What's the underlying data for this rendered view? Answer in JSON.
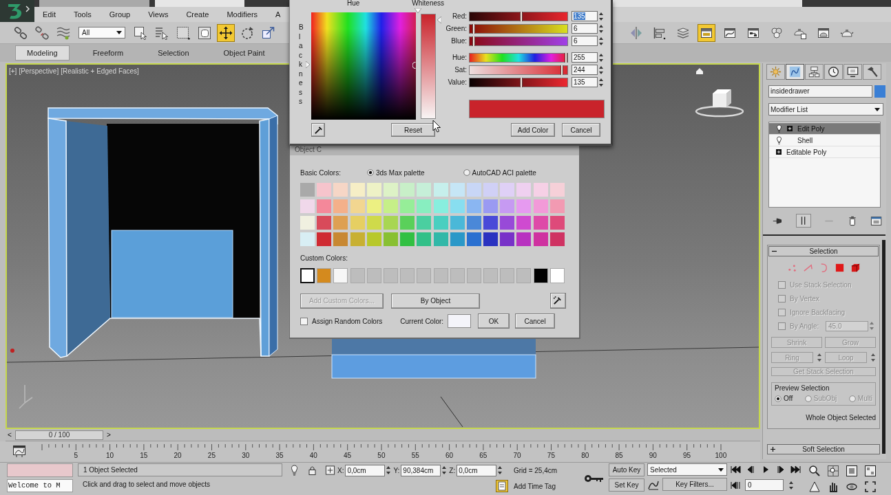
{
  "menu_bar": [
    "Edit",
    "Tools",
    "Group",
    "Views",
    "Create",
    "Modifiers",
    "A"
  ],
  "main_toolbar": {
    "link_tools": [
      {
        "kind": "link",
        "active": false
      },
      {
        "kind": "unlink",
        "active": false
      },
      {
        "kind": "bind",
        "active": false
      }
    ],
    "selection_filter": "All",
    "select_tools": [
      {
        "kind": "select",
        "active": false
      },
      {
        "kind": "select_by_name",
        "active": false
      },
      {
        "kind": "region",
        "active": false
      },
      {
        "kind": "crossing",
        "active": false
      },
      {
        "kind": "move",
        "active": true
      },
      {
        "kind": "rotate",
        "active": false
      },
      {
        "kind": "scale",
        "active": false
      }
    ],
    "right_tools": [
      {
        "kind": "mirror",
        "active": false
      },
      {
        "kind": "align",
        "active": false
      },
      {
        "kind": "layers",
        "active": false
      },
      {
        "kind": "ribbon",
        "active": true
      },
      {
        "kind": "curve_editor",
        "active": false
      },
      {
        "kind": "schematic",
        "active": false
      },
      {
        "kind": "material",
        "active": false
      },
      {
        "kind": "render_setup",
        "active": false
      },
      {
        "kind": "frame_window",
        "active": false
      },
      {
        "kind": "render",
        "active": false
      }
    ]
  },
  "ribbon_tabs": [
    {
      "label": "Modeling",
      "selected": true
    },
    {
      "label": "Freeform",
      "selected": false
    },
    {
      "label": "Selection",
      "selected": false
    },
    {
      "label": "Object Paint",
      "selected": false
    }
  ],
  "viewport": {
    "labels": [
      "[+]",
      "[Perspective]",
      "[Realistic + Edged Faces]"
    ]
  },
  "color_selector": {
    "hue_label": "Hue",
    "whiteness_label": "Whiteness",
    "blackness_label": "Blackness",
    "channels": [
      {
        "kind": "red",
        "label": "Red:",
        "value": "135",
        "level": 0.53,
        "focused": true
      },
      {
        "kind": "green",
        "label": "Green:",
        "value": "6",
        "level": 0.03,
        "focused": false
      },
      {
        "kind": "blue",
        "label": "Blue:",
        "value": "6",
        "level": 0.03,
        "focused": false
      },
      {
        "kind": "hue",
        "label": "Hue:",
        "value": "255",
        "level": 1.0,
        "focused": false
      },
      {
        "kind": "sat",
        "label": "Sat:",
        "value": "244",
        "level": 0.96,
        "focused": false
      },
      {
        "kind": "value",
        "label": "Value:",
        "value": "135",
        "level": 0.53,
        "focused": false
      }
    ],
    "preview": {
      "color": "#c9232b"
    },
    "reset_button": "Reset",
    "add_color_button": "Add Color",
    "cancel_button": "Cancel"
  },
  "object_color": {
    "title": "Object C",
    "basic_colors_label": "Basic Colors:",
    "palettes": [
      {
        "label": "3ds Max palette",
        "selected": true
      },
      {
        "label": "AutoCAD ACI palette",
        "selected": false
      }
    ],
    "basic_colors": [
      [
        {
          "color": "#a9a9a9"
        },
        {
          "color": "#f6c4cc"
        },
        {
          "color": "#f6d6c6"
        },
        {
          "color": "#f6eec6"
        },
        {
          "color": "#eef2c6"
        },
        {
          "color": "#ddf2c6"
        },
        {
          "color": "#c8efc8"
        },
        {
          "color": "#c6efd8"
        },
        {
          "color": "#c6efec"
        },
        {
          "color": "#c6e6f6"
        },
        {
          "color": "#c8d6f6"
        },
        {
          "color": "#d0d0f6"
        },
        {
          "color": "#dfd0f6"
        },
        {
          "color": "#efd0f0"
        },
        {
          "color": "#f6d0e6"
        },
        {
          "color": "#f6d0d8"
        }
      ],
      [
        {
          "color": "#f0d8ea"
        },
        {
          "color": "#f4889a"
        },
        {
          "color": "#f4b08a"
        },
        {
          "color": "#f2d690"
        },
        {
          "color": "#ecf082"
        },
        {
          "color": "#c6ef88"
        },
        {
          "color": "#96ee98"
        },
        {
          "color": "#88eec0"
        },
        {
          "color": "#88eede"
        },
        {
          "color": "#88def0"
        },
        {
          "color": "#8ab6f2"
        },
        {
          "color": "#9a9af2"
        },
        {
          "color": "#c69af2"
        },
        {
          "color": "#e69af0"
        },
        {
          "color": "#f29ad8"
        },
        {
          "color": "#f29ab2"
        }
      ],
      [
        {
          "color": "#f0f0e0"
        },
        {
          "color": "#d84a5a"
        },
        {
          "color": "#dea052"
        },
        {
          "color": "#e6cf62"
        },
        {
          "color": "#cfda4a"
        },
        {
          "color": "#a8d652"
        },
        {
          "color": "#5ad05a"
        },
        {
          "color": "#4acfa0"
        },
        {
          "color": "#4acfc0"
        },
        {
          "color": "#4ab8d8"
        },
        {
          "color": "#4a88d8"
        },
        {
          "color": "#4a4ad8"
        },
        {
          "color": "#984ad8"
        },
        {
          "color": "#cf4ad0"
        },
        {
          "color": "#de4aa8"
        },
        {
          "color": "#de4a7a"
        }
      ],
      [
        {
          "color": "#d8eef4"
        },
        {
          "color": "#cf2a32"
        },
        {
          "color": "#c88832"
        },
        {
          "color": "#c8b032"
        },
        {
          "color": "#b8c82a"
        },
        {
          "color": "#88c032"
        },
        {
          "color": "#32c042"
        },
        {
          "color": "#32c088"
        },
        {
          "color": "#32b8a8"
        },
        {
          "color": "#2a98c8"
        },
        {
          "color": "#2a70d0"
        },
        {
          "color": "#2a32c0"
        },
        {
          "color": "#7832c8"
        },
        {
          "color": "#b832c0"
        },
        {
          "color": "#cf32a0"
        },
        {
          "color": "#cf3262"
        }
      ]
    ],
    "custom_colors_label": "Custom Colors:",
    "custom_colors": [
      {
        "color": "#ffffff",
        "selected": true
      },
      {
        "color": "#d48a1e",
        "selected": false
      },
      {
        "color": "#f6f6f6",
        "selected": false
      },
      {
        "color": "#bdbdbd",
        "selected": false
      },
      {
        "color": "#bdbdbd",
        "selected": false
      },
      {
        "color": "#bdbdbd",
        "selected": false
      },
      {
        "color": "#bdbdbd",
        "selected": false
      },
      {
        "color": "#bdbdbd",
        "selected": false
      },
      {
        "color": "#bdbdbd",
        "selected": false
      },
      {
        "color": "#bdbdbd",
        "selected": false
      },
      {
        "color": "#bdbdbd",
        "selected": false
      },
      {
        "color": "#bdbdbd",
        "selected": false
      },
      {
        "color": "#bdbdbd",
        "selected": false
      },
      {
        "color": "#bdbdbd",
        "selected": false
      },
      {
        "color": "#000000",
        "selected": false
      },
      {
        "color": "#ffffff",
        "selected": false
      }
    ],
    "add_custom_button": {
      "label": "Add Custom Colors...",
      "disabled": true
    },
    "by_object_button": "By Object",
    "assign_random": {
      "label": "Assign Random Colors",
      "checked": false
    },
    "current_color": {
      "label": "Current Color:",
      "color": "#f4f4fa"
    },
    "ok_button": "OK",
    "cancel_button": "Cancel"
  },
  "command_panel": {
    "tabs": [
      {
        "kind": "create",
        "selected": false
      },
      {
        "kind": "modify",
        "selected": true
      },
      {
        "kind": "hierarchy",
        "selected": false
      },
      {
        "kind": "motion",
        "selected": false
      },
      {
        "kind": "display",
        "selected": false
      },
      {
        "kind": "utilities",
        "selected": false
      }
    ],
    "object_name": "insidedrawer",
    "object_swatch": {
      "color": "#3a7fd5"
    },
    "modifier_list": "Modifier List",
    "stack": [
      {
        "kind": "modifier",
        "label": "Edit Poly",
        "expandable": true,
        "selected": true
      },
      {
        "kind": "modifier",
        "label": "Shell",
        "expandable": false,
        "selected": false
      },
      {
        "kind": "base",
        "label": "Editable Poly",
        "expandable": true,
        "selected": false
      }
    ],
    "selection_rollout": {
      "title": "Selection",
      "expanded": true,
      "disabled": true,
      "options": [
        {
          "label": "Use Stack Selection",
          "checked": false
        },
        {
          "label": "By Vertex",
          "checked": false
        },
        {
          "label": "Ignore Backfacing",
          "checked": false
        }
      ],
      "by_angle": {
        "label": "By Angle:",
        "checked": false,
        "value": "45.0"
      },
      "shrink_button": "Shrink",
      "grow_button": "Grow",
      "ring_button": "Ring",
      "loop_button": "Loop",
      "get_stack_button": "Get Stack Selection",
      "preview": {
        "label": "Preview Selection",
        "options": [
          {
            "label": "Off",
            "selected": true,
            "disabled": false
          },
          {
            "label": "SubObj",
            "selected": false,
            "disabled": true
          },
          {
            "label": "Multi",
            "selected": false,
            "disabled": true
          }
        ]
      },
      "status": "Whole Object Selected"
    },
    "soft_selection_rollout": {
      "title": "Soft Selection",
      "expanded": false
    }
  },
  "time_slider": {
    "prev": "<",
    "position": "0 / 100",
    "next": ">",
    "level": 0
  },
  "track_bar": {
    "frames": [
      "5",
      "10",
      "15",
      "20",
      "25",
      "30",
      "35",
      "40",
      "45",
      "50",
      "55",
      "60",
      "65",
      "70",
      "75",
      "80",
      "85",
      "90",
      "95",
      "100"
    ]
  },
  "status_bar": {
    "listener_text": "Welcome to M",
    "selection_info": "1 Object Selected",
    "prompt": "Click and drag to select and move objects",
    "coords": [
      {
        "axis": "X:",
        "value": "0,0cm"
      },
      {
        "axis": "Y:",
        "value": "90,384cm"
      },
      {
        "axis": "Z:",
        "value": "0,0cm"
      }
    ],
    "grid": "Grid = 25,4cm",
    "time_tag": "Add Time Tag",
    "auto_key": "Auto Key",
    "set_key": "Set Key",
    "key_mode": "Selected",
    "key_filters": "Key Filters...",
    "frame": "0"
  }
}
